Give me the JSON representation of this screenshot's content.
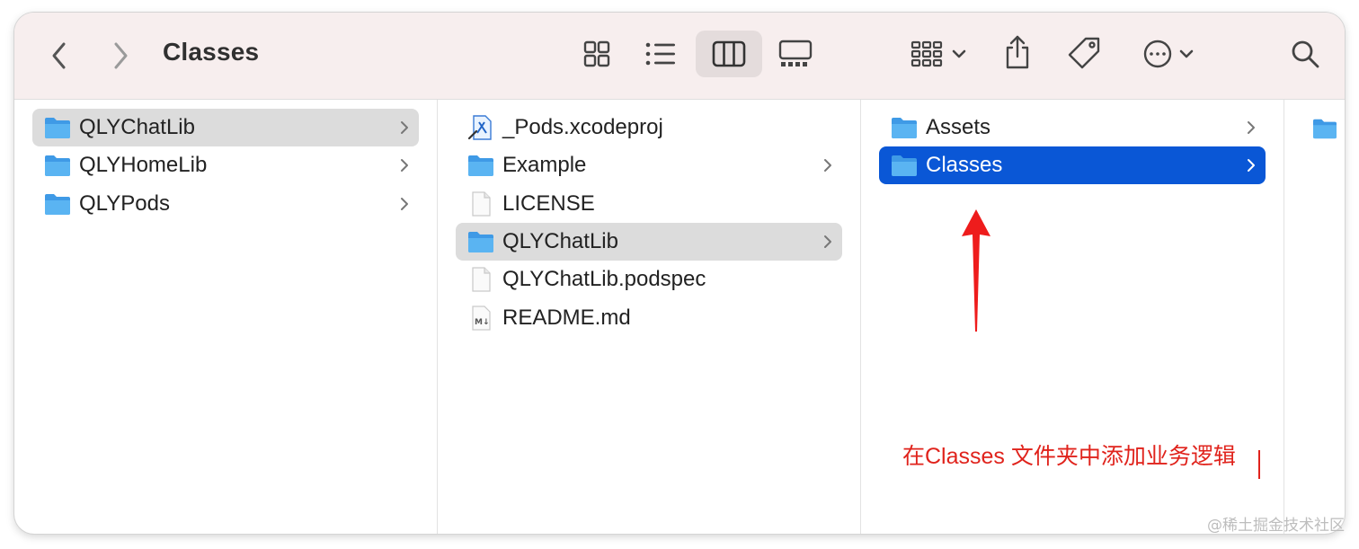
{
  "window": {
    "title": "Classes"
  },
  "toolbar": {
    "back_icon": "chevron-left-icon",
    "forward_icon": "chevron-right-icon",
    "views": [
      "icon-view-icon",
      "list-view-icon",
      "column-view-icon",
      "gallery-view-icon"
    ],
    "selected_view": "column-view-icon",
    "group_icon": "group-icon",
    "share_icon": "share-icon",
    "tag_icon": "tag-icon",
    "more_icon": "more-icon",
    "search_icon": "search-icon"
  },
  "columns": [
    {
      "items": [
        {
          "label": "QLYChatLib",
          "type": "folder",
          "has_children": true,
          "state": "selected-inactive"
        },
        {
          "label": "QLYHomeLib",
          "type": "folder",
          "has_children": true,
          "state": "normal"
        },
        {
          "label": "QLYPods",
          "type": "folder",
          "has_children": true,
          "state": "normal"
        }
      ]
    },
    {
      "items": [
        {
          "label": "_Pods.xcodeproj",
          "type": "xcodeproj",
          "has_children": false,
          "state": "normal"
        },
        {
          "label": "Example",
          "type": "folder",
          "has_children": true,
          "state": "normal"
        },
        {
          "label": "LICENSE",
          "type": "file",
          "has_children": false,
          "state": "normal"
        },
        {
          "label": "QLYChatLib",
          "type": "folder",
          "has_children": true,
          "state": "selected-inactive"
        },
        {
          "label": "QLYChatLib.podspec",
          "type": "file",
          "has_children": false,
          "state": "normal"
        },
        {
          "label": "README.md",
          "type": "markdown",
          "has_children": false,
          "state": "normal"
        }
      ]
    },
    {
      "items": [
        {
          "label": "Assets",
          "type": "folder",
          "has_children": true,
          "state": "normal"
        },
        {
          "label": "Classes",
          "type": "folder",
          "has_children": true,
          "state": "selected-active"
        }
      ]
    }
  ],
  "annotation": {
    "text": "在Classes 文件夹中添加业务逻辑",
    "color": "#e0231c"
  },
  "watermark": "@稀土掘金技术社区",
  "colors": {
    "selection_blue": "#0a57d6",
    "selection_grey": "#dcdcdc",
    "folder_blue": "#4aa8ee",
    "toolbar_bg": "#f7eeee"
  }
}
